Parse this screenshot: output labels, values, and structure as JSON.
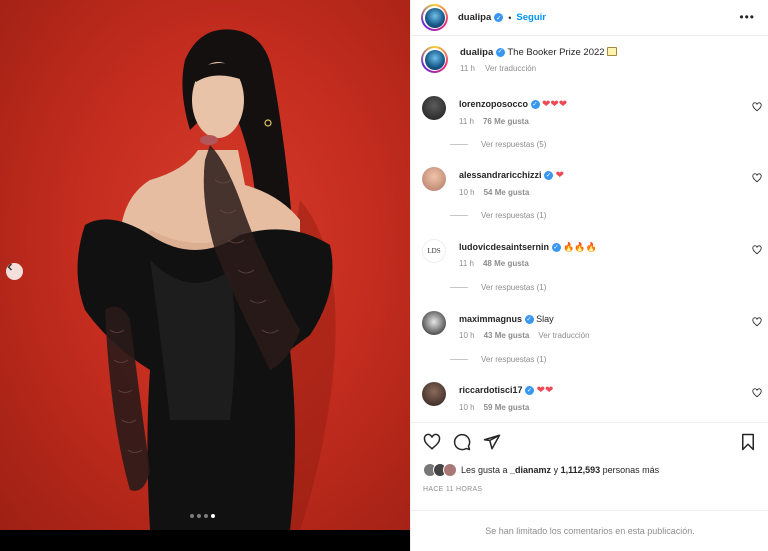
{
  "header": {
    "username": "dualipa",
    "follow_label": "Seguir",
    "more_icon": "more-options-icon"
  },
  "caption": {
    "username": "dualipa",
    "text": "The Booker Prize 2022",
    "time": "11 h",
    "translate_label": "Ver traducción"
  },
  "comments": [
    {
      "username": "lorenzoposocco",
      "text": "❤❤❤",
      "time": "11 h",
      "likes": "76 Me gusta",
      "replies": "Ver respuestas (5)"
    },
    {
      "username": "alessandraricchizzi",
      "text": "❤",
      "time": "10 h",
      "likes": "54 Me gusta",
      "replies": "Ver respuestas (1)"
    },
    {
      "username": "ludovicdesaintsernin",
      "text": "🔥🔥🔥",
      "time": "11 h",
      "likes": "48 Me gusta",
      "replies": "Ver respuestas (1)"
    },
    {
      "username": "maximmagnus",
      "text": "Slay",
      "time": "10 h",
      "likes": "43 Me gusta",
      "translate": "Ver traducción",
      "replies": "Ver respuestas (1)"
    },
    {
      "username": "riccardotisci17",
      "text": "❤❤",
      "time": "10 h",
      "likes": "59 Me gusta"
    }
  ],
  "likes_summary": {
    "prefix": "Les gusta a ",
    "user": "_dianamz",
    "middle": " y ",
    "count": "1,112,593",
    "suffix": " personas más"
  },
  "time_ago": "HACE 11 HORAS",
  "comments_limited": "Se han limitado los comentarios en esta publicación.",
  "carousel": {
    "total": 4,
    "active_index": 4
  },
  "colors": {
    "accent": "#0095f6",
    "like_red": "#ed4956",
    "verified": "#3897f0",
    "backdrop": "#c52d1f"
  }
}
